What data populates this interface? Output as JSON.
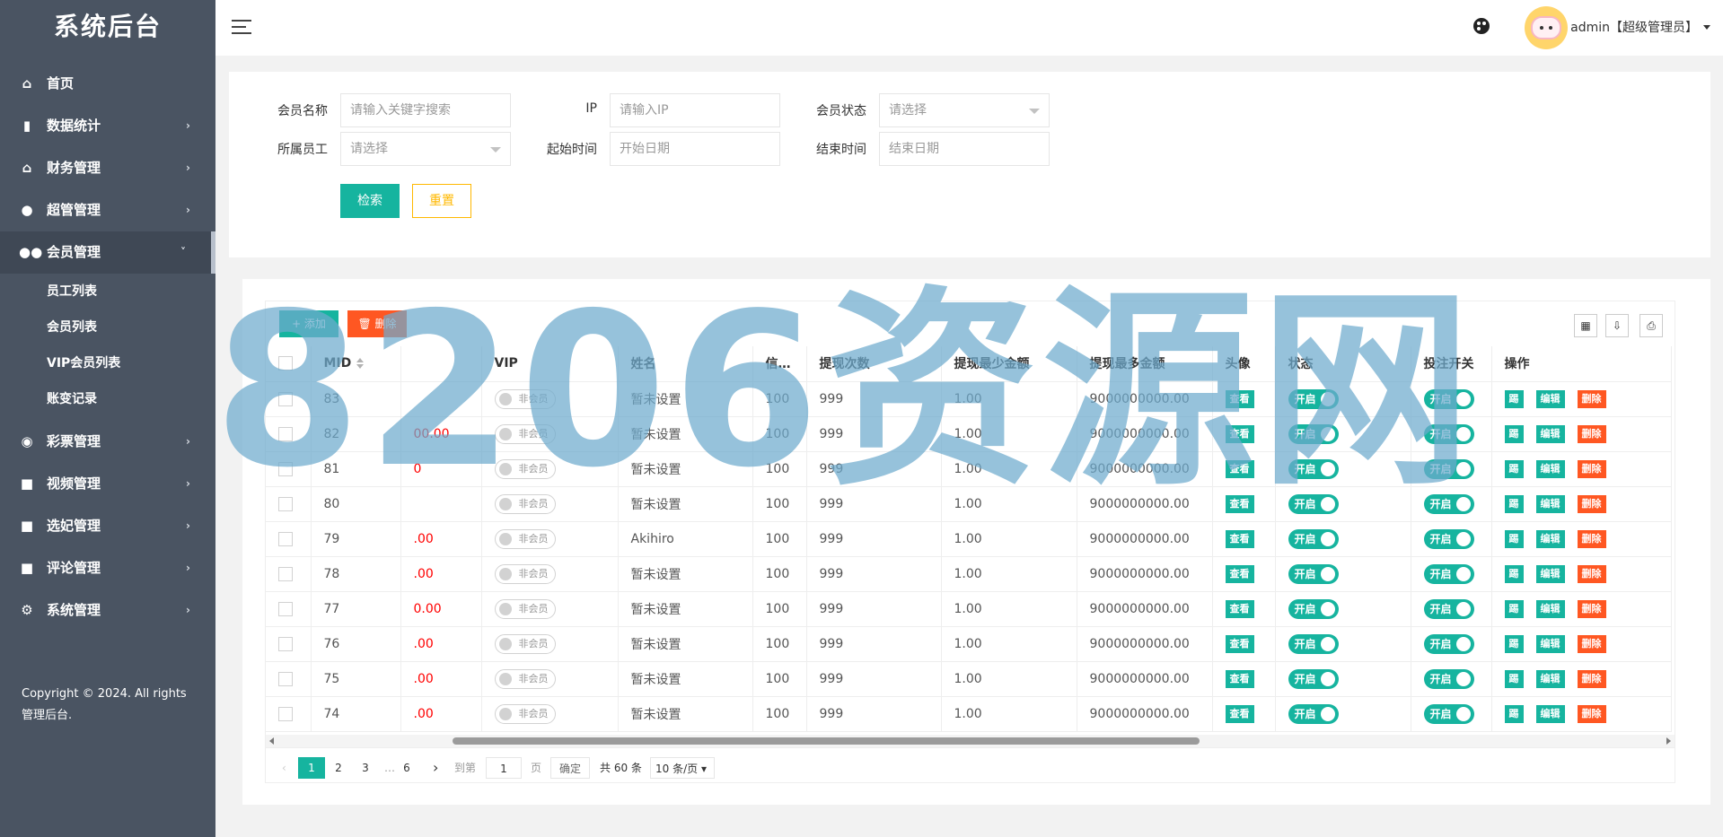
{
  "sidebar": {
    "logo": "系统后台",
    "items": [
      {
        "label": "首页",
        "icon": "home-icon"
      },
      {
        "label": "数据统计",
        "icon": "chart-icon"
      },
      {
        "label": "财务管理",
        "icon": "bank-icon"
      },
      {
        "label": "超管管理",
        "icon": "user-icon"
      },
      {
        "label": "会员管理",
        "icon": "users-icon"
      },
      {
        "label": "彩票管理",
        "icon": "gamepad-icon"
      },
      {
        "label": "视频管理",
        "icon": "video-icon"
      },
      {
        "label": "选妃管理",
        "icon": "video-icon"
      },
      {
        "label": "评论管理",
        "icon": "video-icon"
      },
      {
        "label": "系统管理",
        "icon": "gear-icon"
      }
    ],
    "submenu": [
      "员工列表",
      "会员列表",
      "VIP会员列表",
      "账变记录"
    ],
    "copyright": "Copyright © 2024. All rights 管理后台."
  },
  "header": {
    "user": "admin【超级管理员】"
  },
  "search": {
    "labels": {
      "member_name": "会员名称",
      "ip": "IP",
      "member_status": "会员状态",
      "staff": "所属员工",
      "start_time": "起始时间",
      "end_time": "结束时间"
    },
    "placeholders": {
      "member_name": "请输入关键字搜索",
      "ip": "请输入IP",
      "member_status": "请选择",
      "staff": "请选择",
      "start_time": "开始日期",
      "end_time": "结束日期"
    },
    "search_label": "检索",
    "reset_label": "重置"
  },
  "toolbar": {
    "add_label": "+ 添加",
    "delete_label": "🗑 删除"
  },
  "table": {
    "headers": [
      "MID",
      "",
      "VIP",
      "姓名",
      "信…",
      "提现次数",
      "提现最少金额",
      "提现最多金额",
      "头像",
      "状态",
      "投注开关",
      "操作"
    ],
    "rows": [
      {
        "mid": "83",
        "balance": "",
        "vip": "非会员",
        "name": "暂未设置",
        "credit": "100",
        "count": "999",
        "min": "1.00",
        "max": "9000000000.00"
      },
      {
        "mid": "82",
        "balance": "00.00",
        "vip": "非会员",
        "name": "暂未设置",
        "credit": "100",
        "count": "999",
        "min": "1.00",
        "max": "9000000000.00"
      },
      {
        "mid": "81",
        "balance": "0",
        "vip": "非会员",
        "name": "暂未设置",
        "credit": "100",
        "count": "999",
        "min": "1.00",
        "max": "9000000000.00"
      },
      {
        "mid": "80",
        "balance": "",
        "vip": "非会员",
        "name": "暂未设置",
        "credit": "100",
        "count": "999",
        "min": "1.00",
        "max": "9000000000.00"
      },
      {
        "mid": "79",
        "balance": ".00",
        "vip": "非会员",
        "name": "Akihiro",
        "credit": "100",
        "count": "999",
        "min": "1.00",
        "max": "9000000000.00"
      },
      {
        "mid": "78",
        "balance": ".00",
        "vip": "非会员",
        "name": "暂未设置",
        "credit": "100",
        "count": "999",
        "min": "1.00",
        "max": "9000000000.00"
      },
      {
        "mid": "77",
        "balance": "0.00",
        "vip": "非会员",
        "name": "暂未设置",
        "credit": "100",
        "count": "999",
        "min": "1.00",
        "max": "9000000000.00"
      },
      {
        "mid": "76",
        "balance": ".00",
        "vip": "非会员",
        "name": "暂未设置",
        "credit": "100",
        "count": "999",
        "min": "1.00",
        "max": "9000000000.00"
      },
      {
        "mid": "75",
        "balance": ".00",
        "vip": "非会员",
        "name": "暂未设置",
        "credit": "100",
        "count": "999",
        "min": "1.00",
        "max": "9000000000.00"
      },
      {
        "mid": "74",
        "balance": ".00",
        "vip": "非会员",
        "name": "暂未设置",
        "credit": "100",
        "count": "999",
        "min": "1.00",
        "max": "9000000000.00"
      }
    ],
    "view_label": "查看",
    "on_label": "开启",
    "kick_label": "踢",
    "edit_label": "编辑",
    "delete_label": "删除"
  },
  "pager": {
    "pages": [
      "1",
      "2",
      "3",
      "…",
      "6"
    ],
    "goto_prefix": "到第",
    "goto_value": "1",
    "goto_suffix": "页",
    "confirm": "确定",
    "total": "共 60 条",
    "page_size": "10 条/页"
  },
  "watermark": "8206资源网",
  "colors": {
    "sidebar": "#4a5462",
    "primary": "#16b49f",
    "danger": "#ff5722",
    "warning": "#ffb800"
  }
}
